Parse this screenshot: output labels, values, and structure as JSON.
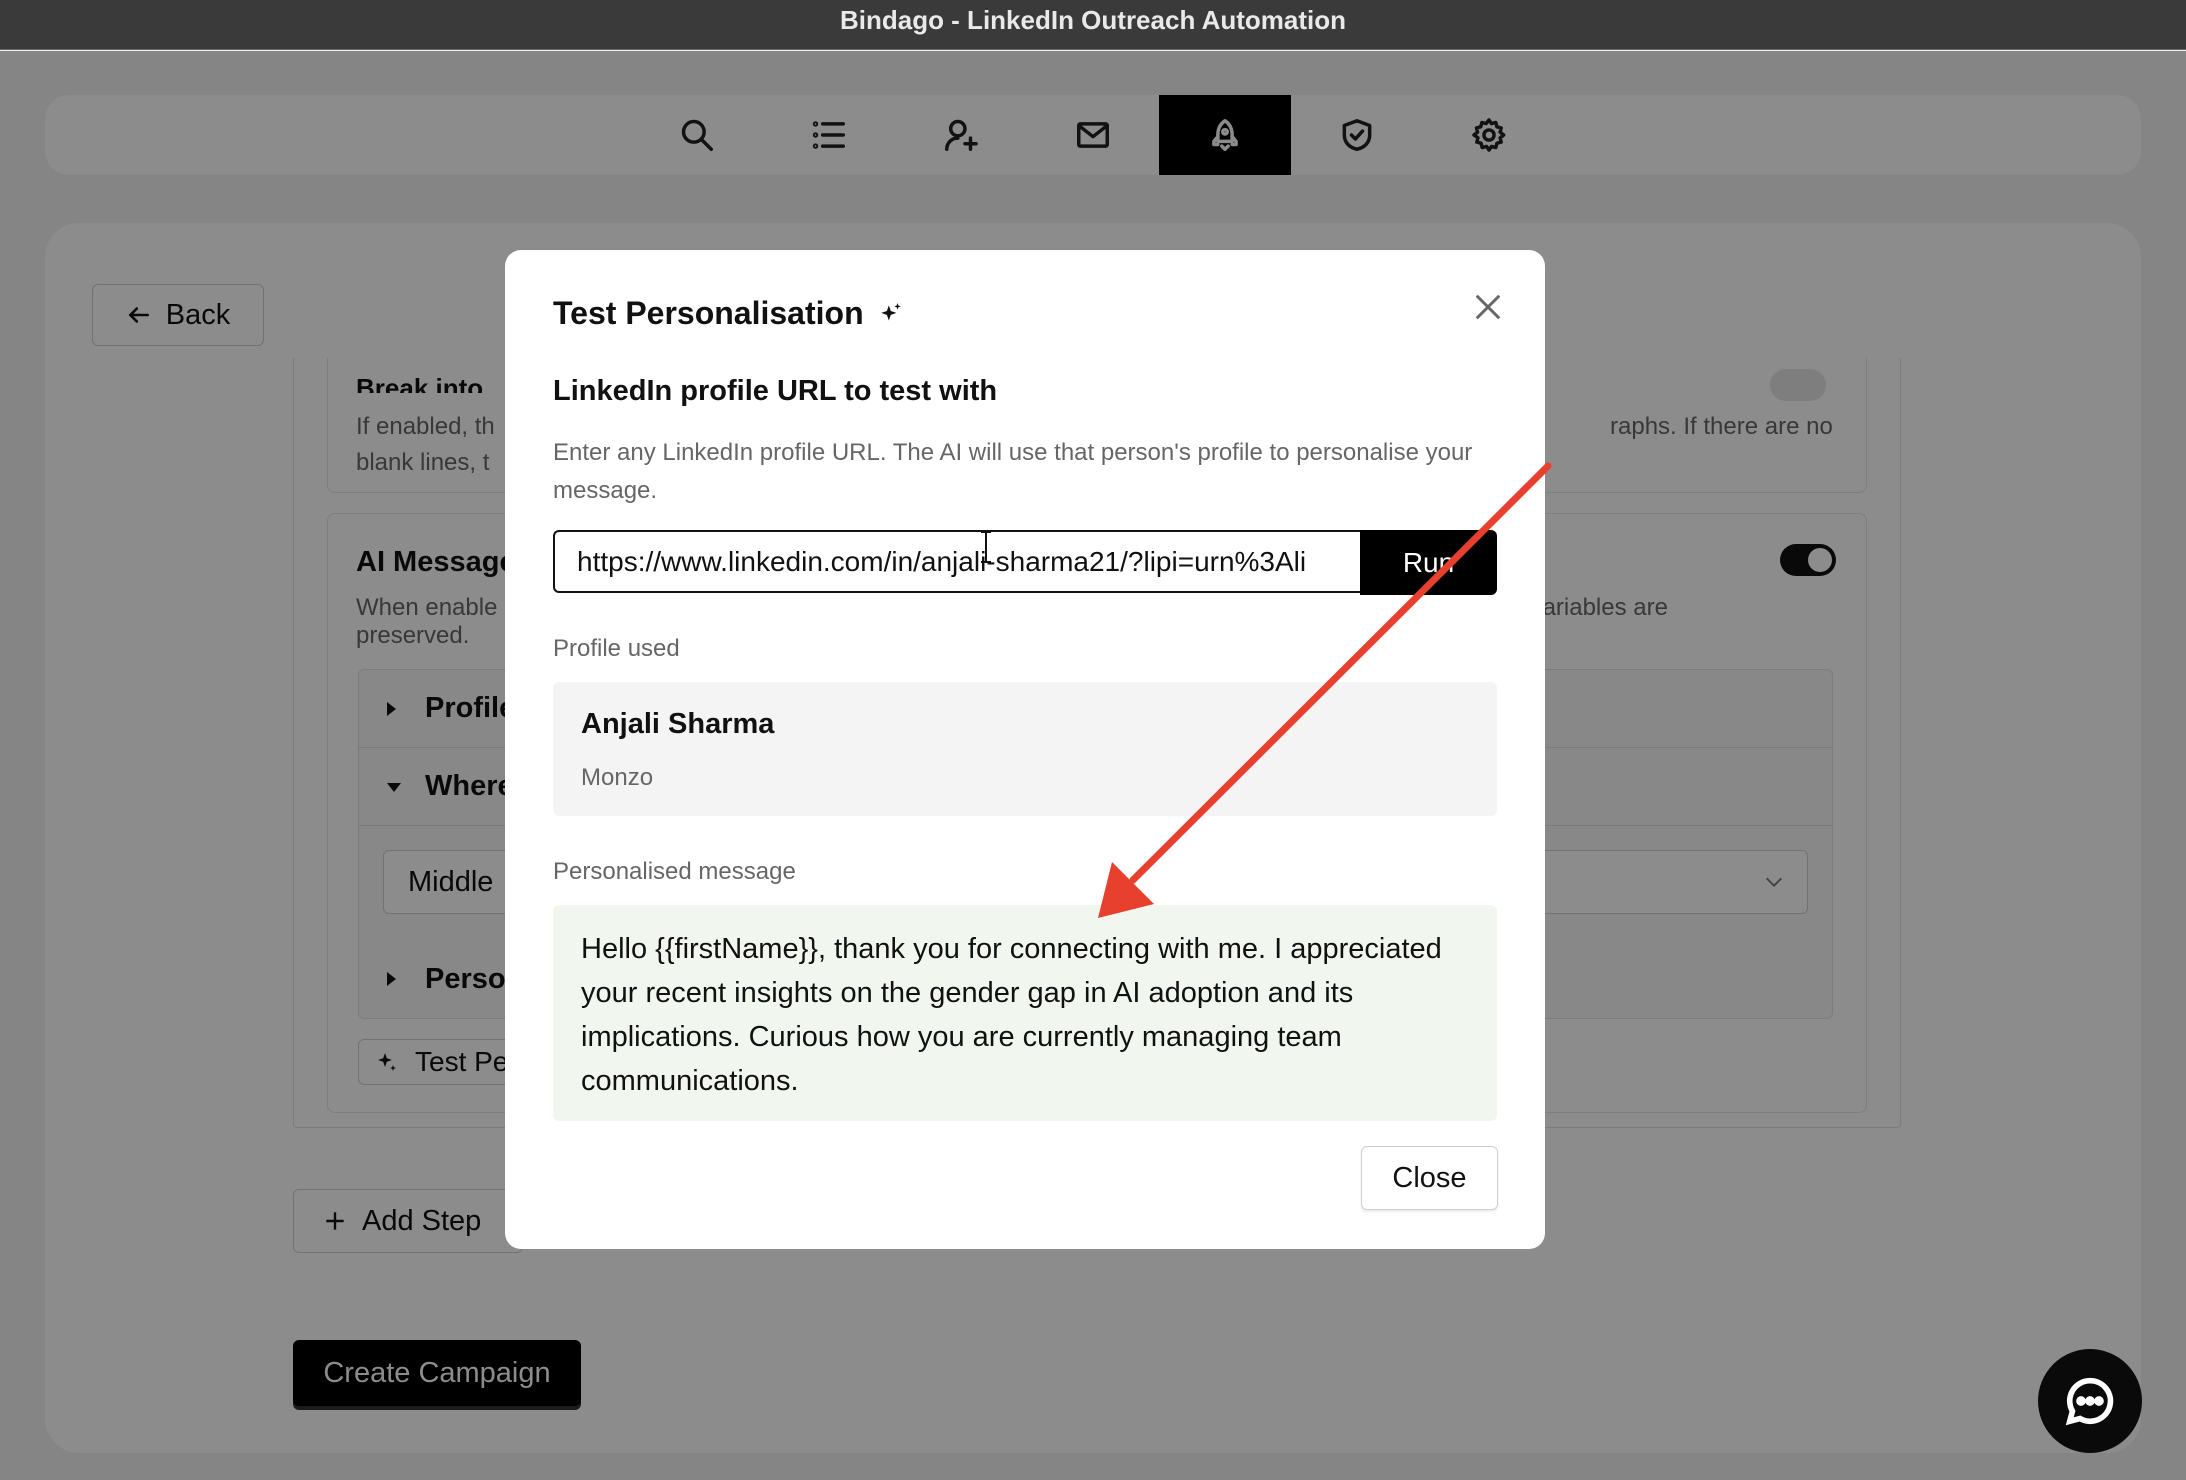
{
  "window": {
    "title": "Bindago - LinkedIn Outreach Automation"
  },
  "nav": {
    "items": [
      {
        "name": "search-icon"
      },
      {
        "name": "list-icon"
      },
      {
        "name": "add-user-icon"
      },
      {
        "name": "mail-icon"
      },
      {
        "name": "rocket-icon",
        "active": true
      },
      {
        "name": "shield-check-icon"
      },
      {
        "name": "gear-icon"
      }
    ]
  },
  "page": {
    "back_label": "Back",
    "card1": {
      "title": "Break into",
      "desc_left_1": "If enabled, th",
      "desc_right_1": "raphs. If there are no",
      "desc_left_2": "blank lines, t"
    },
    "card2": {
      "title": "AI Message",
      "desc_left": "When enable",
      "desc_left_2": "preserved.",
      "desc_right": ". Variables are",
      "rows": [
        "Profile",
        "Where",
        "Perso"
      ],
      "select_value": "Middle",
      "test_label": "Test Pe"
    },
    "add_step_label": "Add Step",
    "create_label": "Create Campaign"
  },
  "modal": {
    "title": "Test Personalisation",
    "url_label": "LinkedIn profile URL to test with",
    "help": "Enter any LinkedIn profile URL. The AI will use that person's profile to personalise your message.",
    "url_value": "https://www.linkedin.com/in/anjali-sharma21/?lipi=urn%3Ali",
    "run_label": "Run",
    "profile_label": "Profile used",
    "profile_name": "Anjali Sharma",
    "profile_company": "Monzo",
    "message_label": "Personalised message",
    "message": "Hello {{firstName}}, thank you for connecting with me. I appreciated your recent insights on the gender gap in AI adoption and its implications. Curious how you are currently managing team communications.",
    "close_label": "Close"
  },
  "colors": {
    "annotation_arrow": "#e8402e",
    "message_bg": "#f1f7ef"
  }
}
